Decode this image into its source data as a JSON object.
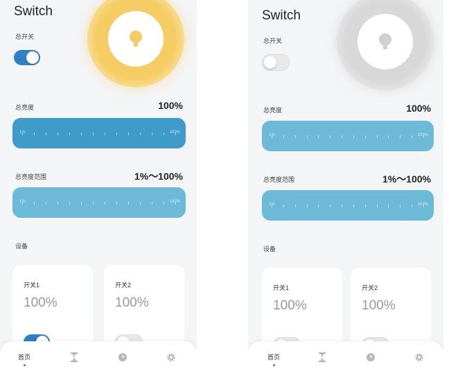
{
  "screens": [
    {
      "title": "Switch",
      "master_switch": {
        "label": "总开关",
        "on": true
      },
      "brightness": {
        "label": "总亮度",
        "value": "100%",
        "level": 1.0
      },
      "brightness_range": {
        "label": "总亮度范围",
        "value": "1%～100%"
      },
      "slider_min_label": "1%",
      "slider_max_label": "100%",
      "devices_label": "设备",
      "devices": [
        {
          "name": "开关1",
          "level": "100%",
          "on": true
        },
        {
          "name": "开关2",
          "level": "100%",
          "on": false
        }
      ],
      "nav": {
        "home": "首页"
      },
      "bulb_color": "#f6cd65"
    },
    {
      "title": "Switch",
      "master_switch": {
        "label": "总开关",
        "on": false
      },
      "brightness": {
        "label": "总亮度",
        "value": "100%",
        "level": 1.0
      },
      "brightness_range": {
        "label": "总亮度范围",
        "value": "1%～100%"
      },
      "slider_min_label": "1%",
      "slider_max_label": "100%",
      "devices_label": "设备",
      "devices": [
        {
          "name": "开关1",
          "level": "100%",
          "on": false
        },
        {
          "name": "开关2",
          "level": "100%",
          "on": false
        }
      ],
      "nav": {
        "home": "首页"
      },
      "bulb_color": "#d8d8d8"
    }
  ],
  "colors": {
    "accent": "#2f80c4",
    "slider_dark": "#3f9bc7",
    "slider_light": "#6cbad8",
    "background": "#f4f5f7"
  },
  "nav_icons": [
    "home",
    "hourglass-icon",
    "clock-icon",
    "gear-icon"
  ]
}
